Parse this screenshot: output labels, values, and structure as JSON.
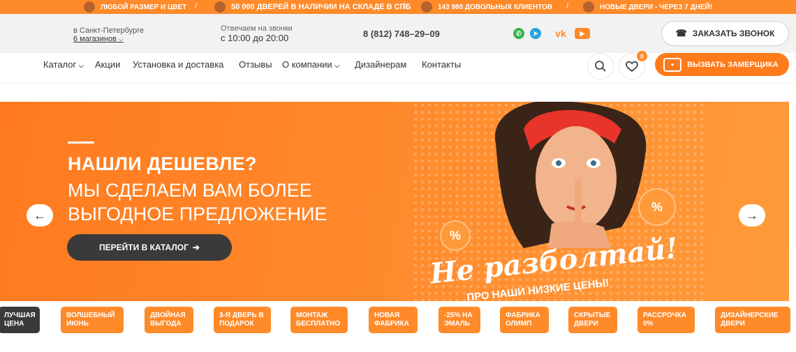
{
  "promo": {
    "items": [
      "ЛЮБОЙ РАЗМЕР И ЦВЕТ",
      "50 000 ДВЕРЕЙ В НАЛИЧИИ НА СКЛАДЕ В СПБ",
      "143 980 ДОВОЛЬНЫХ КЛИЕНТОВ",
      "НОВЫЕ ДВЕРИ - ЧЕРЕЗ 7 ДНЕЙ!"
    ],
    "separator": "/"
  },
  "contact": {
    "city": "в Санкт-Петербурге",
    "stores": "6 магазинов",
    "hours_label": "Отвечаем на звонки",
    "hours": "с 10:00 до 20:00",
    "phone": "8 (812) 748–29–09",
    "socials": [
      "whatsapp-icon",
      "telegram-icon",
      "vk-icon",
      "youtube-icon"
    ],
    "call_button": "ЗАКАЗАТЬ ЗВОНОК"
  },
  "nav": {
    "items": [
      "Каталог",
      "Акции",
      "Установка и доставка",
      "Отзывы",
      "О компании",
      "Дизайнерам",
      "Контакты"
    ],
    "favorites_count": "0",
    "measure_button": "ВЫЗВАТЬ ЗАМЕРЩИКА"
  },
  "banner": {
    "heading": "НАШЛИ ДЕШЕВЛЕ?",
    "subheading": "МЫ СДЕЛАЕМ ВАМ БОЛЕЕ ВЫГОДНОЕ ПРЕДЛОЖЕНИЕ",
    "cta": "ПЕРЕЙТИ В КАТАЛОГ",
    "slogan": "Не разболтай!",
    "slogan_sub": "ПРО НАШИ НИЗКИЕ ЦЕНЫ!",
    "percent_sign": "%"
  },
  "tiles": [
    "ЛУЧШАЯ ЦЕНА",
    "ВОЛШЕБНЫЙ ИЮНЬ",
    "ДВОЙНАЯ ВЫГОДА",
    "3-Я ДВЕРЬ В ПОДАРОК",
    "МОНТАЖ БЕСПЛАТНО",
    "НОВАЯ ФАБРИКА",
    "-25% НА ЭМАЛЬ",
    "ФАБРИКА ОЛИМП",
    "СКРЫТЫЕ ДВЕРИ",
    "РАССРОЧКА 0%",
    "ДИЗАЙНЕРСКИЕ ДВЕРИ"
  ],
  "colors": {
    "accent": "#ff8a2a",
    "dark": "#3a3a3a"
  }
}
